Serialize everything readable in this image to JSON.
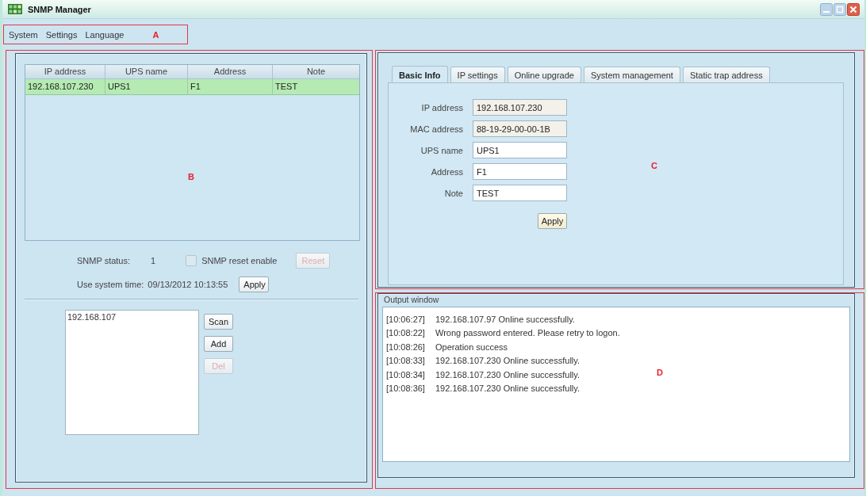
{
  "window": {
    "title": "SNMP Manager"
  },
  "menu_bar": {
    "items": [
      "System",
      "Settings",
      "Language"
    ],
    "callout": "A"
  },
  "left_panel": {
    "callout": "B",
    "device_table": {
      "columns": [
        "IP address",
        "UPS name",
        "Address",
        "Note"
      ],
      "rows": [
        {
          "cells": [
            "192.168.107.230",
            "UPS1",
            "F1",
            "TEST"
          ],
          "selected": true
        }
      ]
    },
    "snmp_status": {
      "label": "SNMP status:",
      "value": "1"
    },
    "snmp_reset": {
      "label": "SNMP reset enable",
      "checked": false
    },
    "reset_button": {
      "label": "Reset",
      "disabled": true
    },
    "system_time": {
      "label": "Use system time:",
      "value": "09/13/2012 10:13:55",
      "button": "Apply"
    },
    "scan_list": {
      "items": [
        "192.168.107"
      ]
    },
    "scan_buttons": [
      {
        "label": "Scan",
        "disabled": false
      },
      {
        "label": "Add",
        "disabled": false
      },
      {
        "label": "Del",
        "disabled": true
      }
    ]
  },
  "settings_panel": {
    "callout": "C",
    "tabs": [
      {
        "label": "Basic Info",
        "selected": true
      },
      {
        "label": "IP settings",
        "selected": false
      },
      {
        "label": "Online upgrade",
        "selected": false
      },
      {
        "label": "System management",
        "selected": false
      },
      {
        "label": "Static trap address",
        "selected": false
      }
    ],
    "fields": [
      {
        "label": "IP address",
        "value": "192.168.107.230",
        "readonly": true
      },
      {
        "label": "MAC address",
        "value": "88-19-29-00-00-1B",
        "readonly": true
      },
      {
        "label": "UPS name",
        "value": "UPS1",
        "readonly": false
      },
      {
        "label": "Address",
        "value": "F1",
        "readonly": false
      },
      {
        "label": "Note",
        "value": "TEST",
        "readonly": false
      }
    ],
    "apply_button": "Apply"
  },
  "output_window": {
    "callout": "D",
    "title": "Output window",
    "lines": [
      {
        "time": "[10:06:27]",
        "message": "192.168.107.97 Online successfully."
      },
      {
        "time": "[10:08:22]",
        "message": "Wrong password entered. Please retry to logon."
      },
      {
        "time": "[10:08:26]",
        "message": "Operation success"
      },
      {
        "time": "[10:08:33]",
        "message": "192.168.107.230 Online successfully."
      },
      {
        "time": "[10:08:34]",
        "message": "192.168.107.230 Online successfully."
      },
      {
        "time": "[10:08:36]",
        "message": "192.168.107.230 Online successfully."
      }
    ]
  }
}
